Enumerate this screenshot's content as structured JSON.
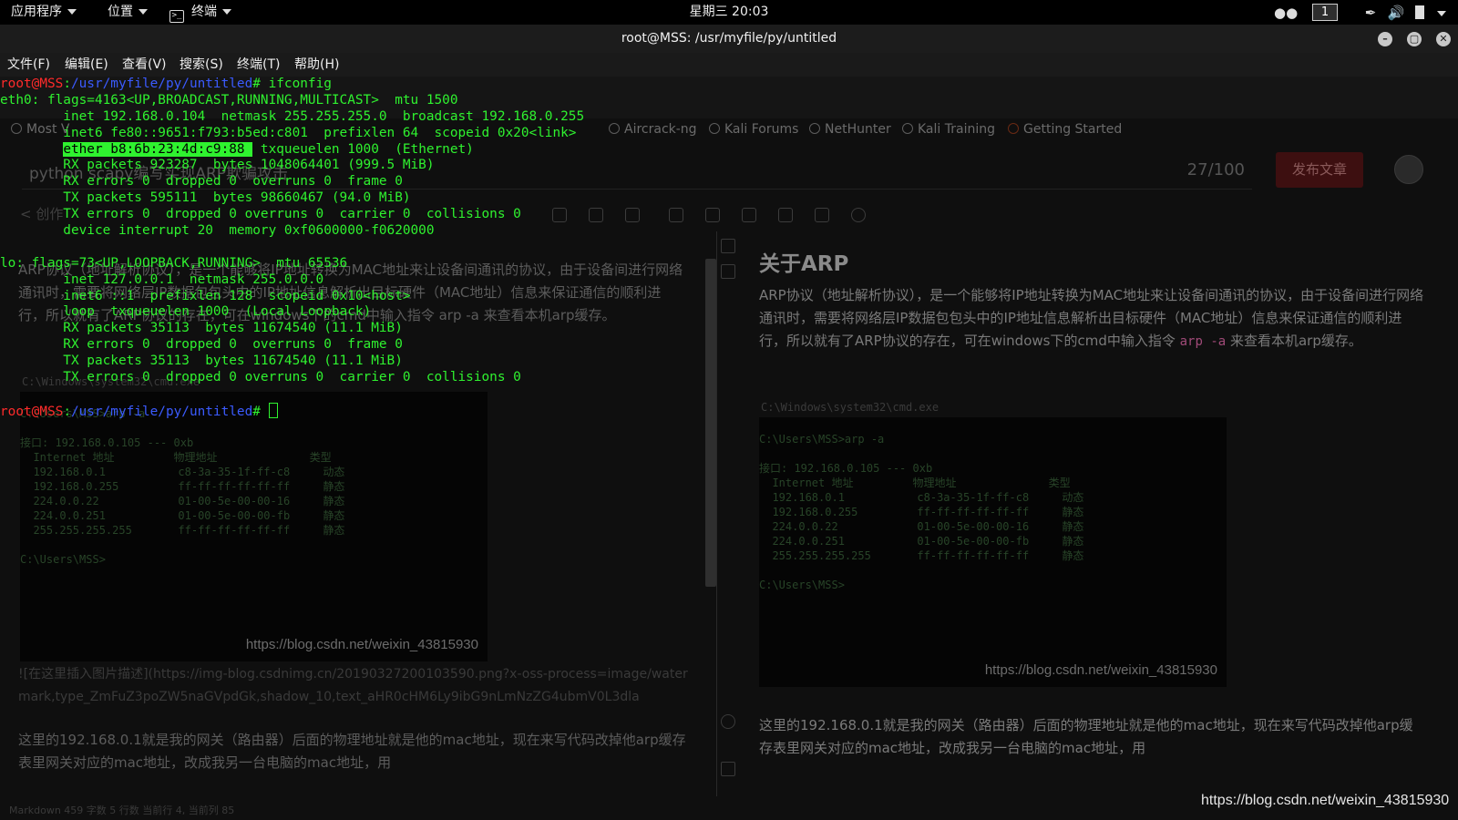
{
  "topbar": {
    "apps": "应用程序",
    "places": "位置",
    "terminal": "终端",
    "clock": "星期三 20:03",
    "workspace": "1"
  },
  "window": {
    "title": "root@MSS: /usr/myfile/py/untitled"
  },
  "menubar": {
    "file": "文件(F)",
    "edit": "编辑(E)",
    "view": "查看(V)",
    "search": "搜索(S)",
    "terminal": "终端(T)",
    "help": "帮助(H)"
  },
  "terminal": {
    "prompt_user": "root@MSS",
    "prompt_path": "/usr/myfile/py/untitled",
    "command": " ifconfig",
    "eth0_lines": [
      "eth0: flags=4163<UP,BROADCAST,RUNNING,MULTICAST>  mtu 1500",
      "        inet 192.168.0.104  netmask 255.255.255.0  broadcast 192.168.0.255",
      "        inet6 fe80::9651:f793:b5ed:c801  prefixlen 64  scopeid 0x20<link>"
    ],
    "ether_highlight": "ether b8:6b:23:4d:c9:88 ",
    "ether_rest": " txqueuelen 1000  (Ethernet)",
    "eth0_stats": [
      "        RX packets 923287  bytes 1048064401 (999.5 MiB)",
      "        RX errors 0  dropped 0  overruns 0  frame 0",
      "        TX packets 595111  bytes 98660467 (94.0 MiB)",
      "        TX errors 0  dropped 0 overruns 0  carrier 0  collisions 0",
      "        device interrupt 20  memory 0xf0600000-f0620000  "
    ],
    "lo_lines": [
      "lo: flags=73<UP,LOOPBACK,RUNNING>  mtu 65536",
      "        inet 127.0.0.1  netmask 255.0.0.0",
      "        inet6 ::1  prefixlen 128  scopeid 0x10<host>",
      "        loop  txqueuelen 1000  (Local Loopback)",
      "        RX packets 35113  bytes 11674540 (11.1 MiB)",
      "        RX errors 0  dropped 0  overruns 0  frame 0",
      "        TX packets 35113  bytes 11674540 (11.1 MiB)",
      "        TX errors 0  dropped 0 overruns 0  carrier 0  collisions 0"
    ]
  },
  "ghost": {
    "bookmarks": [
      "Most V",
      "Aircrack-ng",
      "Kali Forums",
      "NetHunter",
      "Kali Training",
      "Getting Started"
    ],
    "title_input": "python scapy编写实现ARP欺骗攻击",
    "counter": "27/100",
    "publish": "发布文章",
    "create_label": "< 创作",
    "left_para": "ARP协议（地址解析协议），是一个能够将IP地址转换为MAC地址来让设备间通讯的协议，由于设备间进行网络通讯时，需要将网络层IP数据包包头中的IP地址信息解析出目标硬件（MAC地址）信息来保证通信的顺利进行，所以就有了ARP协议的存在，可在windows下的cmd中输入指令 arp -a 来查看本机arp缓存。",
    "cmd_title": "C:\\Windows\\system32\\cmd.exe",
    "img_link": "![在这里插入图片描述](https://img-blog.csdnimg.cn/20190327200103590.png?x-oss-process=image/watermark,type_ZmFuZ3poZW5naGVpdGk,shadow_10,text_aHR0cHM6Ly9ibG9nLmNzZG4ubmV0L3dla",
    "left_para2": "这里的192.168.0.1就是我的网关（路由器）后面的物理地址就是他的mac地址，现在来写代码改掉他arp缓存表里网关对应的mac地址，改成我另一台电脑的mac地址，用",
    "right_heading": "关于ARP",
    "right_para_a": "ARP协议（地址解析协议），是一个能够将IP地址转换为MAC地址来让设备间通讯的协议，由于设备间进行网络通讯时，需要将网络层IP数据包包头中的IP地址信息解析出目标硬件（MAC地址）信息来保证通信的顺利进行，所以就有了ARP协议的存在，可在windows下的cmd中输入指令 ",
    "right_code": "arp -a",
    "right_para_b": " 来查看本机arp缓存。",
    "right_para2": "这里的192.168.0.1就是我的网关（路由器）后面的物理地址就是他的mac地址，现在来写代码改掉他arp缓存表里网关对应的mac地址，改成我另一台电脑的mac地址，用",
    "cmd_lines": [
      "C:\\Users\\MSS>arp -a",
      "",
      "接口: 192.168.0.105 --- 0xb",
      "  Internet 地址         物理地址              类型",
      "  192.168.0.1           c8-3a-35-1f-ff-c8     动态",
      "  192.168.0.255         ff-ff-ff-ff-ff-ff     静态",
      "  224.0.0.22            01-00-5e-00-00-16     静态",
      "  224.0.0.251           01-00-5e-00-00-fb     静态",
      "  255.255.255.255       ff-ff-ff-ff-ff-ff     静态",
      "",
      "C:\\Users\\MSS>"
    ],
    "cmd_watermark": "https://blog.csdn.net/weixin_43815930",
    "status": "Markdown  459 字数  5 行数  当前行 4, 当前列 85"
  },
  "watermark": "https://blog.csdn.net/weixin_43815930"
}
